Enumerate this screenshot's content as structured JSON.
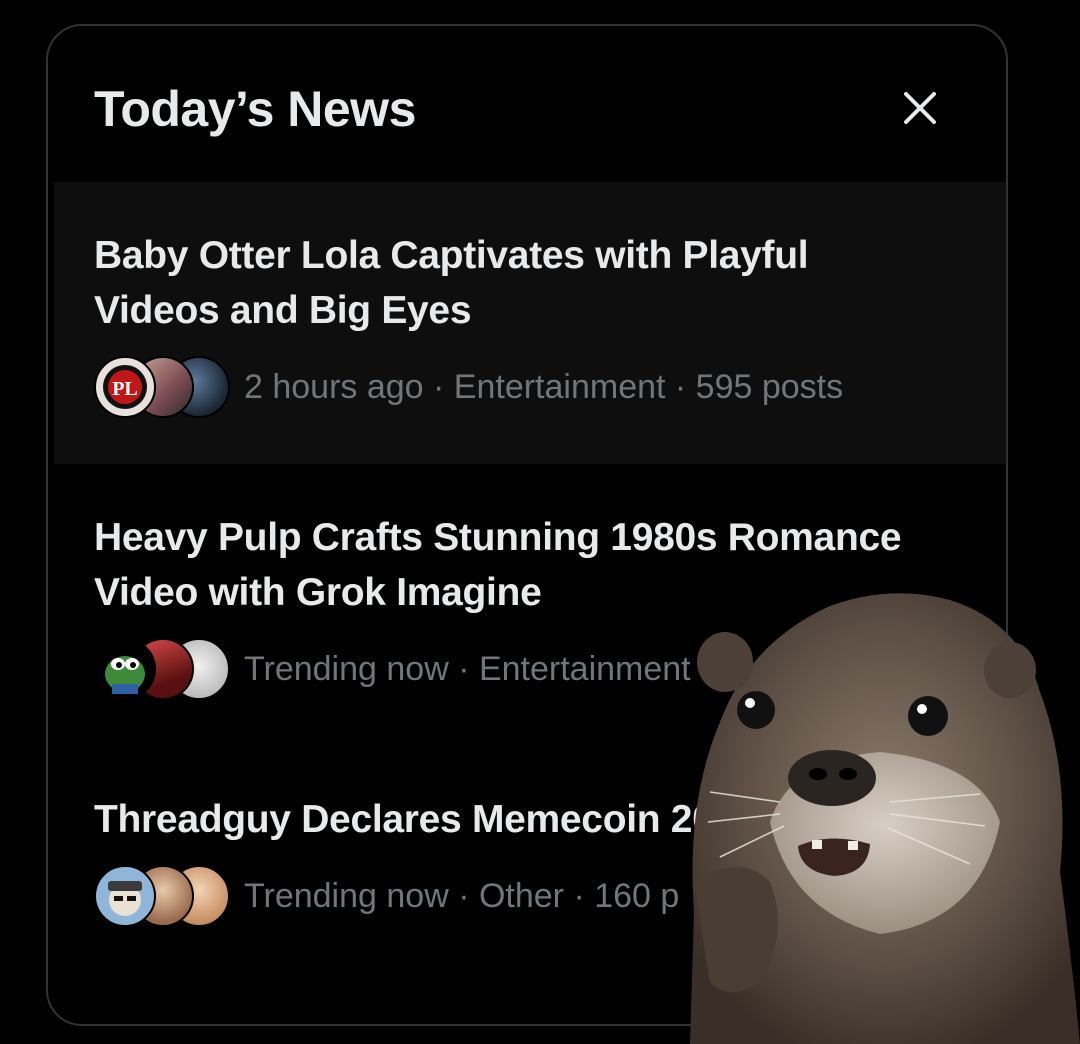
{
  "panel": {
    "title": "Today’s News",
    "close_icon": "close-icon"
  },
  "news": [
    {
      "headline": "Baby Otter Lola Captivates with Playful Videos and Big Eyes",
      "meta": "2 hours ago · Entertainment · 595 posts"
    },
    {
      "headline": "Heavy Pulp Crafts Stunning 1980s Romance Video with Grok Imagine",
      "meta": "Trending now · Entertainment"
    },
    {
      "headline": "Threadguy Declares Memecoin 2026",
      "meta": "Trending now · Other · 160 p"
    }
  ],
  "overlay": {
    "sticker": "otter-sticker"
  },
  "colors": {
    "background": "#000000",
    "text": "#e7e9ea",
    "secondary_text": "#71767b",
    "border": "#2f3336",
    "hover_row": "#0e0e0e"
  }
}
